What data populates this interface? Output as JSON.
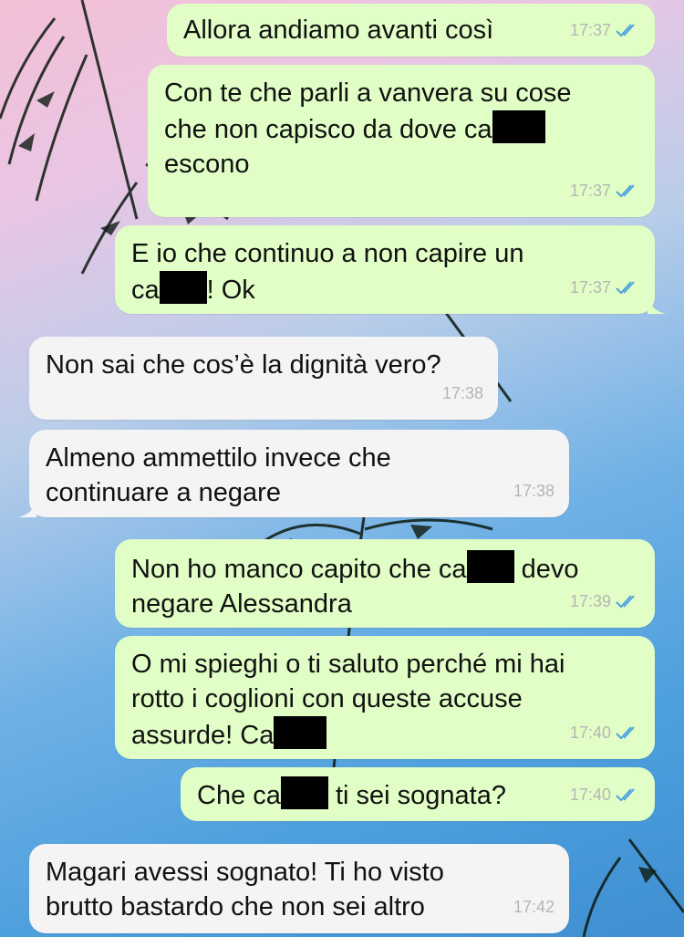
{
  "theme": {
    "outgoing_bubble": "#e1fec6",
    "incoming_bubble": "#f4f4f4",
    "read_ticks": "#4fa3e0"
  },
  "messages": [
    {
      "id": "m1",
      "direction": "out",
      "parts": [
        "Allora andiamo avanti così"
      ],
      "time": "17:37",
      "status": "read"
    },
    {
      "id": "m2",
      "direction": "out",
      "parts": [
        "Con te che parli a vanvera su cose\nche non capisco da dove ca",
        "[redacted]",
        "\nescono"
      ],
      "time": "17:37",
      "status": "read"
    },
    {
      "id": "m3",
      "direction": "out",
      "parts": [
        "E io che continuo a non capire un\nca",
        "[redacted]",
        "! Ok"
      ],
      "time": "17:37",
      "status": "read"
    },
    {
      "id": "m4",
      "direction": "in",
      "parts": [
        "Non sai che cos’è la dignità vero?"
      ],
      "time": "17:38"
    },
    {
      "id": "m5",
      "direction": "in",
      "parts": [
        "Almeno ammettilo invece che\ncontinuare a negare"
      ],
      "time": "17:38"
    },
    {
      "id": "m6",
      "direction": "out",
      "parts": [
        "Non ho manco capito che ca",
        "[redacted]",
        " devo\nnegare Alessandra"
      ],
      "time": "17:39",
      "status": "read"
    },
    {
      "id": "m7",
      "direction": "out",
      "parts": [
        "O mi spieghi o ti saluto perché mi hai\nrotto i coglioni con queste accuse\nassurde! Ca",
        "[redacted]"
      ],
      "time": "17:40",
      "status": "read"
    },
    {
      "id": "m8",
      "direction": "out",
      "parts": [
        "Che ca",
        "[redacted]",
        " ti sei sognata?"
      ],
      "time": "17:40",
      "status": "read"
    },
    {
      "id": "m9",
      "direction": "in",
      "parts": [
        "Magari avessi sognato! Ti ho visto\nbrutto bastardo che non sei altro"
      ],
      "time": "17:42"
    }
  ]
}
